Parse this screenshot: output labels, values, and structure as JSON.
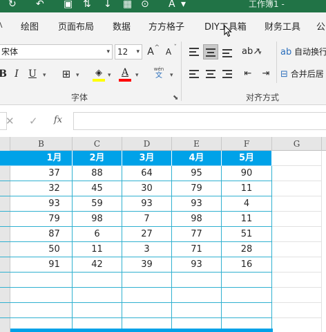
{
  "title": {
    "doc_name": "工作簿1 -"
  },
  "tabs": [
    "绘图",
    "页面布局",
    "数据",
    "方方格子",
    "DIY工具箱",
    "财务工具",
    "公"
  ],
  "font": {
    "name": "宋体",
    "size": "12",
    "grow_label": "A",
    "shrink_label": "A",
    "bold": "B",
    "italic": "I",
    "underline": "U",
    "fill_color": "#ffff00",
    "font_color": "#ff0000",
    "phonetic_top": "wén",
    "phonetic_bottom": "文",
    "group_label": "字体"
  },
  "align": {
    "wrap_label": "自动换行",
    "merge_label": "合并后居",
    "group_label": "对齐方式"
  },
  "formula_bar": {
    "fx_label": "fx",
    "value": ""
  },
  "grid": {
    "columns": [
      "B",
      "C",
      "D",
      "E",
      "F",
      "G"
    ],
    "header_row": [
      "1月",
      "2月",
      "3月",
      "4月",
      "5月"
    ],
    "rows": [
      [
        "37",
        "88",
        "64",
        "95",
        "90"
      ],
      [
        "32",
        "45",
        "30",
        "79",
        "11"
      ],
      [
        "93",
        "59",
        "93",
        "93",
        "4"
      ],
      [
        "79",
        "98",
        "7",
        "98",
        "11"
      ],
      [
        "87",
        "6",
        "27",
        "77",
        "51"
      ],
      [
        "50",
        "11",
        "3",
        "71",
        "28"
      ],
      [
        "91",
        "42",
        "39",
        "93",
        "16"
      ],
      [
        "",
        "",
        "",
        "",
        ""
      ],
      [
        "",
        "",
        "",
        "",
        ""
      ],
      [
        "",
        "",
        "",
        "",
        ""
      ],
      [
        "",
        "",
        "",
        "",
        ""
      ]
    ],
    "header_color": "#00a2e8",
    "border_color": "#2fb0d0"
  }
}
